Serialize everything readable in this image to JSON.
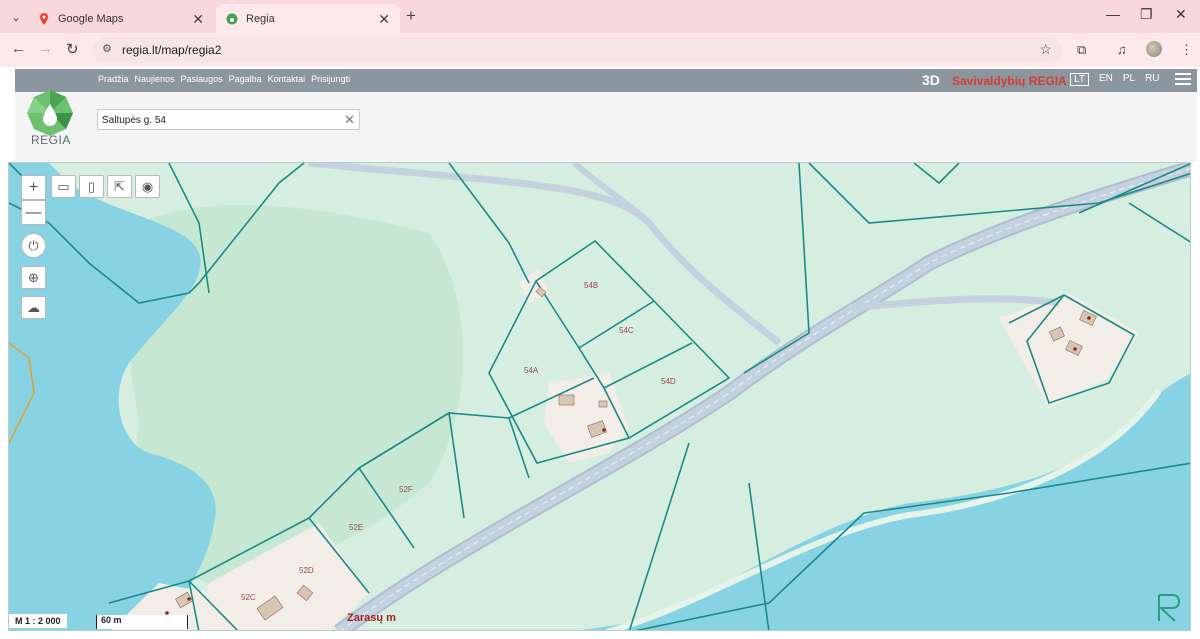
{
  "browser": {
    "tabs": [
      {
        "title": "Google Maps",
        "active": false
      },
      {
        "title": "Regia",
        "active": true
      }
    ],
    "url": "regia.lt/map/regia2"
  },
  "site": {
    "nav": [
      "Pradžia",
      "Naujienos",
      "Paslaugos",
      "Pagalba",
      "Kontaktai",
      "Prisijungti"
    ],
    "btn_3d": "3D",
    "title": "Savivaldybių REGIA",
    "languages": [
      "LT",
      "EN",
      "PL",
      "RU"
    ],
    "active_language": "LT",
    "logo_text": "REGIA",
    "search_value": "Šaltupės g. 54"
  },
  "map": {
    "scale_text": "M 1 : 2 000",
    "scalebar_text": "60 m",
    "place_label": "Zarasų m",
    "parcels": [
      "54B",
      "54C",
      "54A",
      "54D",
      "52F",
      "52E",
      "52D",
      "52C"
    ],
    "colors": {
      "water": "#87d3e3",
      "land": "#d5eedf",
      "boundary": "#1c8a86",
      "road": "#c4d1de",
      "built": "#f3ede7"
    }
  }
}
